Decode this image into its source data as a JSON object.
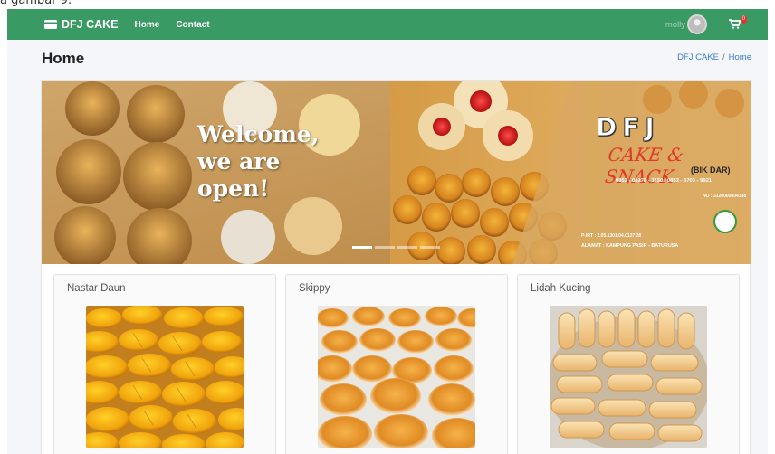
{
  "caption": "a gambar 9.",
  "navbar": {
    "brand": "DFJ CAKE",
    "links": [
      "Home",
      "Contact"
    ],
    "username": "molly",
    "cart_count": "0"
  },
  "header": {
    "title": "Home",
    "breadcrumb": [
      "DFJ CAKE",
      "Home"
    ]
  },
  "banner": {
    "welcome_lines": [
      "Welcome,",
      "we are",
      "open!"
    ],
    "logo_text": "DFJ",
    "subtitle": "CAKE & SNACK",
    "owner": "(BIK DAR)",
    "phone": "0852 - 08278 - 3350 / 0852 - 6703 - 9921",
    "nomor": "NO : 3120000804188",
    "pirt": "P-IRT : 2.05.1301.04.0127.28",
    "alamat": "ALAMAT : KAMPUNG PASIR - BATURUSA",
    "slide_count": 4,
    "active_slide": 1
  },
  "products": [
    {
      "name": "Nastar Daun"
    },
    {
      "name": "Skippy"
    },
    {
      "name": "Lidah Kucing"
    }
  ],
  "colors": {
    "navbar": "#3a9a64",
    "link": "#3a7fd1",
    "background": "#f4f6f9"
  }
}
